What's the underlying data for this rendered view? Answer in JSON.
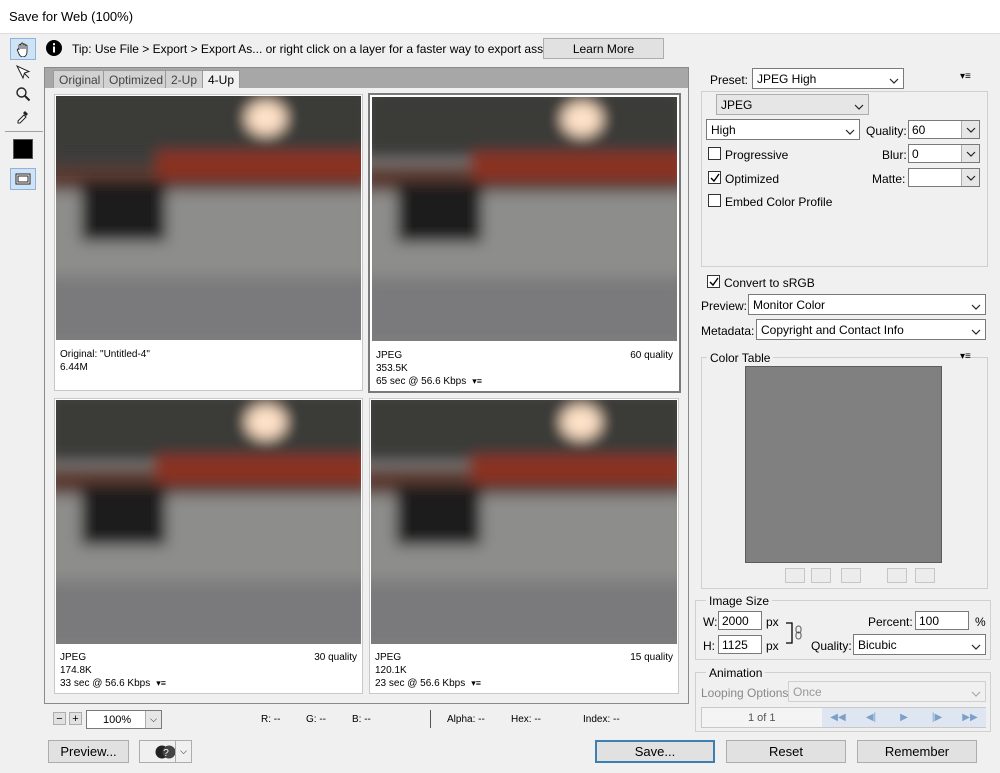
{
  "window": {
    "title": "Save for Web (100%)"
  },
  "tools": [
    {
      "name": "hand-tool-icon"
    },
    {
      "name": "slice-select-icon"
    },
    {
      "name": "zoom-icon"
    },
    {
      "name": "eyedropper-icon"
    }
  ],
  "tip": {
    "text": "Tip: Use File > Export > Export As...  or right click on a layer for a faster way to export assets",
    "button": "Learn More"
  },
  "tabs": [
    "Original",
    "Optimized",
    "2-Up",
    "4-Up"
  ],
  "active_tab": "4-Up",
  "panes": [
    {
      "line1": "Original: \"Untitled-4\"",
      "line2": "6.44M",
      "line3": "",
      "quality": ""
    },
    {
      "line1": "JPEG",
      "line2": "353.5K",
      "line3": "65 sec @ 56.6 Kbps",
      "quality": "60 quality"
    },
    {
      "line1": "JPEG",
      "line2": "174.8K",
      "line3": "33 sec @ 56.6 Kbps",
      "quality": "30 quality"
    },
    {
      "line1": "JPEG",
      "line2": "120.1K",
      "line3": "23 sec @ 56.6 Kbps",
      "quality": "15 quality"
    }
  ],
  "status": {
    "zoom": "100%",
    "r": "R: --",
    "g": "G: --",
    "b": "B: --",
    "alpha": "Alpha: --",
    "hex": "Hex: --",
    "index": "Index: --"
  },
  "bottom": {
    "preview": "Preview...",
    "save": "Save...",
    "reset": "Reset",
    "remember": "Remember"
  },
  "settings": {
    "preset_label": "Preset:",
    "preset_value": "JPEG High",
    "format": "JPEG",
    "compression": "High",
    "quality_label": "Quality:",
    "quality_value": "60",
    "blur_label": "Blur:",
    "blur_value": "0",
    "matte_label": "Matte:",
    "matte_value": "",
    "progressive": {
      "label": "Progressive",
      "checked": false
    },
    "optimized": {
      "label": "Optimized",
      "checked": true
    },
    "embed_profile": {
      "label": "Embed Color Profile",
      "checked": false
    },
    "convert_srgb": {
      "label": "Convert to sRGB",
      "checked": true
    },
    "preview_label": "Preview:",
    "preview_value": "Monitor Color",
    "metadata_label": "Metadata:",
    "metadata_value": "Copyright and Contact Info"
  },
  "color_table": {
    "title": "Color Table"
  },
  "image_size": {
    "title": "Image Size",
    "w_label": "W:",
    "w_value": "2000",
    "w_unit": "px",
    "h_label": "H:",
    "h_value": "1125",
    "h_unit": "px",
    "percent_label": "Percent:",
    "percent_value": "100",
    "percent_unit": "%",
    "quality_label": "Quality:",
    "quality_value": "Bicubic"
  },
  "animation": {
    "title": "Animation",
    "looping_label": "Looping Options:",
    "looping_value": "Once",
    "frame_counter": "1 of 1"
  },
  "colors": {
    "selection_blue": "#cfe3f7",
    "image_gray": "#8a8a8a",
    "light_red": "#c24a2a"
  }
}
